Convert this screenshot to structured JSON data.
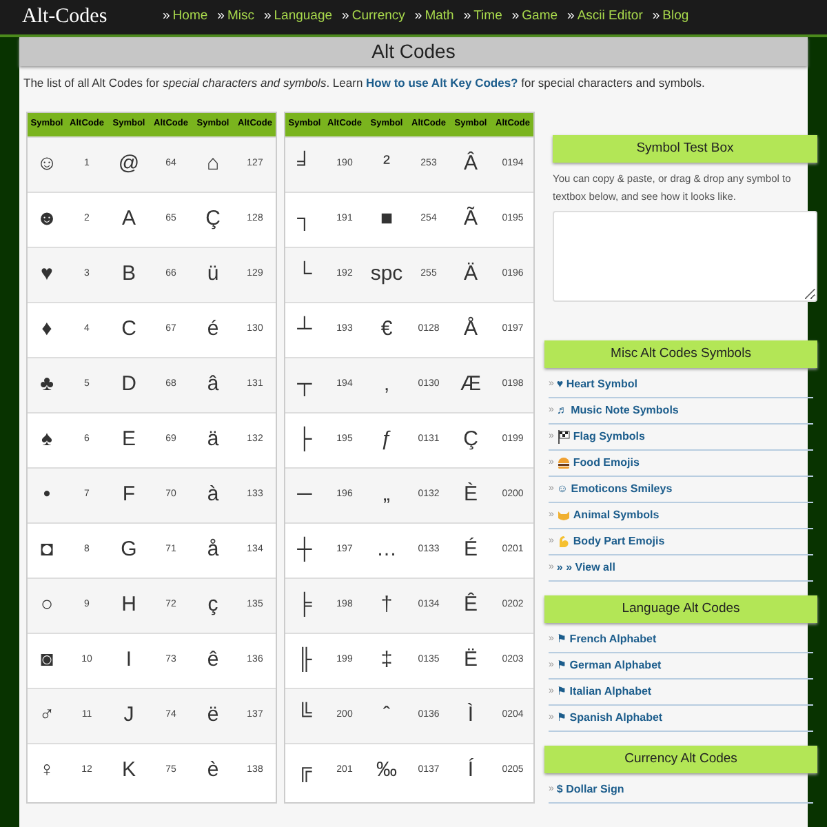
{
  "site": {
    "logo": "Alt-Codes",
    "nav": [
      {
        "marker": "»",
        "label": "Home"
      },
      {
        "marker": "»",
        "label": "Misc"
      },
      {
        "marker": "»",
        "label": "Language"
      },
      {
        "marker": "»",
        "label": "Currency"
      },
      {
        "marker": "»",
        "label": "Math"
      },
      {
        "marker": "»",
        "label": "Time"
      },
      {
        "marker": "»",
        "label": "Game"
      },
      {
        "marker": "»",
        "label": "Ascii Editor"
      },
      {
        "marker": "»",
        "label": "Blog"
      }
    ]
  },
  "page_title": "Alt Codes",
  "intro": {
    "before": "The list of all Alt Codes for *special characters and symbols*. Learn",
    "link": "How to use Alt Key Codes?",
    "after": "for special characters and symbols."
  },
  "tables": [
    {
      "columns": [
        "Symbol",
        "AltCode",
        "Symbol",
        "AltCode",
        "Symbol",
        "AltCode"
      ],
      "rows": [
        [
          "☺",
          "1",
          "@",
          "64",
          "⌂",
          "127"
        ],
        [
          "☻",
          "2",
          "A",
          "65",
          "Ç",
          "128"
        ],
        [
          "♥",
          "3",
          "B",
          "66",
          "ü",
          "129"
        ],
        [
          "♦",
          "4",
          "C",
          "67",
          "é",
          "130"
        ],
        [
          "♣",
          "5",
          "D",
          "68",
          "â",
          "131"
        ],
        [
          "♠",
          "6",
          "E",
          "69",
          "ä",
          "132"
        ],
        [
          "•",
          "7",
          "F",
          "70",
          "à",
          "133"
        ],
        [
          "◘",
          "8",
          "G",
          "71",
          "å",
          "134"
        ],
        [
          "○",
          "9",
          "H",
          "72",
          "ç",
          "135"
        ],
        [
          "◙",
          "10",
          "I",
          "73",
          "ê",
          "136"
        ],
        [
          "♂",
          "11",
          "J",
          "74",
          "ë",
          "137"
        ],
        [
          "♀",
          "12",
          "K",
          "75",
          "è",
          "138"
        ]
      ]
    },
    {
      "columns": [
        "Symbol",
        "AltCode",
        "Symbol",
        "AltCode",
        "Symbol",
        "AltCode"
      ],
      "rows": [
        [
          "╛",
          "190",
          "²",
          "253",
          "Â",
          "0194"
        ],
        [
          "┐",
          "191",
          "■",
          "254",
          "Ã",
          "0195"
        ],
        [
          "└",
          "192",
          "spc",
          "255",
          "Ä",
          "0196"
        ],
        [
          "┴",
          "193",
          "€",
          "0128",
          "Å",
          "0197"
        ],
        [
          "┬",
          "194",
          "‚",
          "0130",
          "Æ",
          "0198"
        ],
        [
          "├",
          "195",
          "ƒ",
          "0131",
          "Ç",
          "0199"
        ],
        [
          "─",
          "196",
          "„",
          "0132",
          "È",
          "0200"
        ],
        [
          "┼",
          "197",
          "…",
          "0133",
          "É",
          "0201"
        ],
        [
          "╞",
          "198",
          "†",
          "0134",
          "Ê",
          "0202"
        ],
        [
          "╟",
          "199",
          "‡",
          "0135",
          "Ë",
          "0203"
        ],
        [
          "╚",
          "200",
          "ˆ",
          "0136",
          "Ì",
          "0204"
        ],
        [
          "╔",
          "201",
          "‰",
          "0137",
          "Í",
          "0205"
        ]
      ]
    }
  ],
  "test_box": {
    "title": "Symbol Test Box",
    "text": "You can copy & paste, or drag & drop any symbol to textbox below, and see how it looks like."
  },
  "sections": [
    {
      "title": "Misc Alt Codes Symbols",
      "marker": "»",
      "links": [
        {
          "kind": "plain",
          "label": "♥ Heart Symbol"
        },
        {
          "kind": "plain",
          "label": "♬ Music Note Symbols"
        },
        {
          "kind": "flag",
          "label": "Flag Symbols"
        },
        {
          "kind": "food",
          "label": "Food Emojis"
        },
        {
          "kind": "plain",
          "label": "☺ Emoticons Smileys"
        },
        {
          "kind": "cat",
          "label": "Animal Symbols"
        },
        {
          "kind": "arm",
          "label": "Body Part Emojis"
        },
        {
          "kind": "plain",
          "label": "» » View all"
        }
      ]
    },
    {
      "title": "Language Alt Codes",
      "marker": "»",
      "links": [
        {
          "kind": "plain",
          "label": "⚑ French Alphabet"
        },
        {
          "kind": "plain",
          "label": "⚑ German Alphabet"
        },
        {
          "kind": "plain",
          "label": "⚑ Italian Alphabet"
        },
        {
          "kind": "plain",
          "label": "⚑ Spanish Alphabet"
        }
      ]
    },
    {
      "title": "Currency Alt Codes",
      "marker": "»",
      "links": [
        {
          "kind": "plain",
          "label": "$ Dollar Sign"
        }
      ]
    }
  ]
}
